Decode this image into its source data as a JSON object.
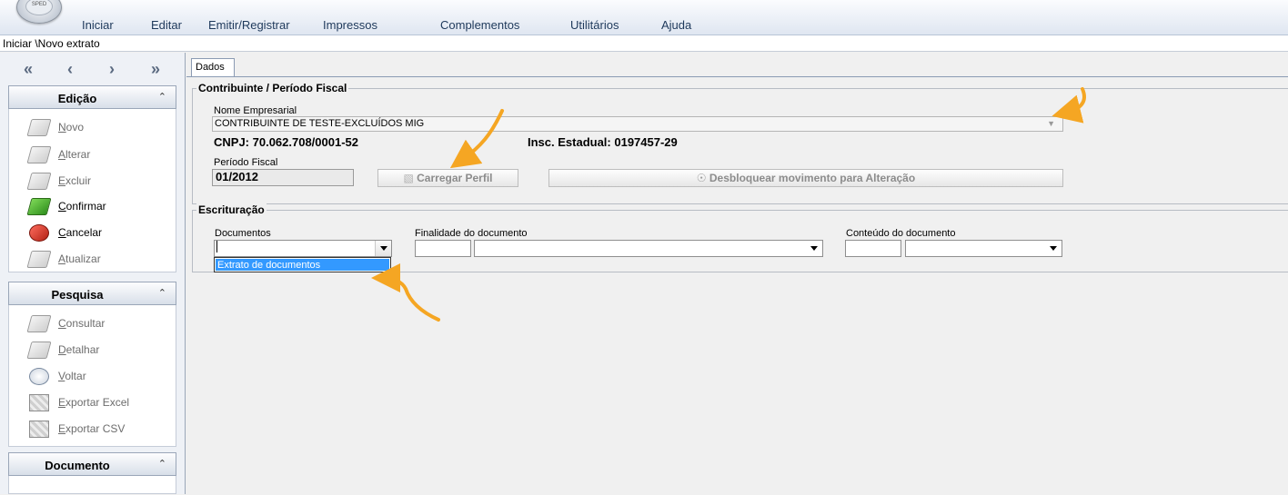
{
  "menu": {
    "items": [
      "Iniciar",
      "Editar",
      "Emitir/Registrar",
      "Impressos",
      "Complementos",
      "Utilitários",
      "Ajuda"
    ]
  },
  "breadcrumb": "Iniciar \\Novo extrato",
  "sidebar": {
    "nav": [
      "«",
      "‹",
      "›",
      "»"
    ],
    "edicao": {
      "title": "Edição",
      "items": [
        {
          "label": "Novo",
          "icon": "new-doc-icon",
          "enabled": false
        },
        {
          "label": "Alterar",
          "icon": "edit-doc-icon",
          "enabled": false
        },
        {
          "label": "Excluir",
          "icon": "delete-doc-icon",
          "enabled": false
        },
        {
          "label": "Confirmar",
          "icon": "confirm-icon",
          "enabled": true
        },
        {
          "label": "Cancelar",
          "icon": "cancel-icon",
          "enabled": true
        },
        {
          "label": "Atualizar",
          "icon": "refresh-icon",
          "enabled": false
        }
      ]
    },
    "pesquisa": {
      "title": "Pesquisa",
      "items": [
        {
          "label": "Consultar",
          "icon": "search-doc-icon",
          "enabled": false
        },
        {
          "label": "Detalhar",
          "icon": "detail-doc-icon",
          "enabled": false
        },
        {
          "label": "Voltar",
          "icon": "back-icon",
          "enabled": false
        },
        {
          "label": "Exportar Excel",
          "icon": "excel-export-icon",
          "enabled": false
        },
        {
          "label": "Exportar CSV",
          "icon": "csv-export-icon",
          "enabled": false
        }
      ]
    },
    "documento": {
      "title": "Documento"
    }
  },
  "tab": {
    "label": "Dados"
  },
  "contribuinte": {
    "group_title": "Contribuinte / Período Fiscal",
    "nome_label": "Nome Empresarial",
    "nome_value": "CONTRIBUINTE DE TESTE-EXCLUÍDOS MIG",
    "cnpj": "CNPJ: 70.062.708/0001-52",
    "ie": "Insc. Estadual: 0197457-29",
    "periodo_label": "Período Fiscal",
    "periodo_value": "01/2012",
    "btn_carregar": "Carregar Perfil",
    "btn_desbloquear": "Desbloquear movimento para Alteração"
  },
  "escrituracao": {
    "group_title": "Escrituração",
    "documentos_label": "Documentos",
    "finalidade_label": "Finalidade do documento",
    "conteudo_label": "Conteúdo do documento",
    "dropdown_option": "Extrato de documentos"
  },
  "colors": {
    "accent_arrow": "#f5a623",
    "selection": "#3399ff"
  }
}
